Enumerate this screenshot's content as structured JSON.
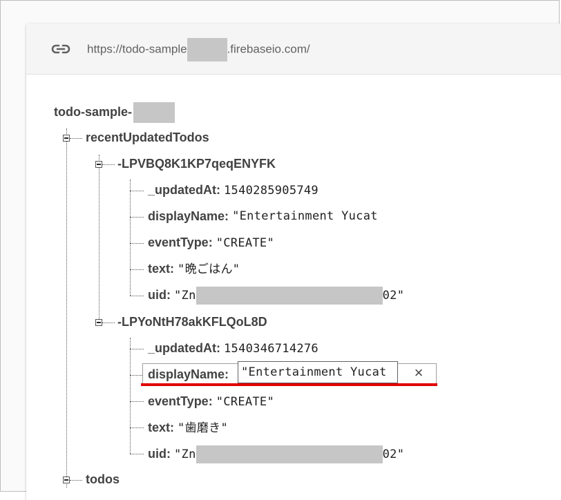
{
  "urlbar": {
    "icon": "link-icon",
    "url_prefix": "https://todo-sample",
    "url_suffix": ".firebaseio.com/"
  },
  "tree": {
    "root_label": "todo-sample-",
    "recent": {
      "label": "recentUpdatedTodos",
      "items": [
        {
          "key": "-LPVBQ8K1KP7qeqENYFK",
          "fields": {
            "updatedAt_key": "_updatedAt:",
            "updatedAt_val": "1540285905749",
            "displayName_key": "displayName:",
            "displayName_val": "\"Entertainment Yucat",
            "eventType_key": "eventType:",
            "eventType_val": "\"CREATE\"",
            "text_key": "text:",
            "text_val": "\"晩ごはん\"",
            "uid_key": "uid:",
            "uid_val_prefix": "\"Zn",
            "uid_val_suffix": "02\""
          }
        },
        {
          "key": "-LPYoNtH78akKFLQoL8D",
          "fields": {
            "updatedAt_key": "_updatedAt:",
            "updatedAt_val": "1540346714276",
            "displayName_key": "displayName:",
            "displayName_val": "\"Entertainment Yucat",
            "eventType_key": "eventType:",
            "eventType_val": "\"CREATE\"",
            "text_key": "text:",
            "text_val": "\"歯磨き\"",
            "uid_key": "uid:",
            "uid_val_prefix": "\"Zn",
            "uid_val_suffix": "02\""
          }
        }
      ]
    },
    "todos_label": "todos"
  },
  "editor": {
    "close_glyph": "×",
    "highlight_color": "#e00000"
  }
}
